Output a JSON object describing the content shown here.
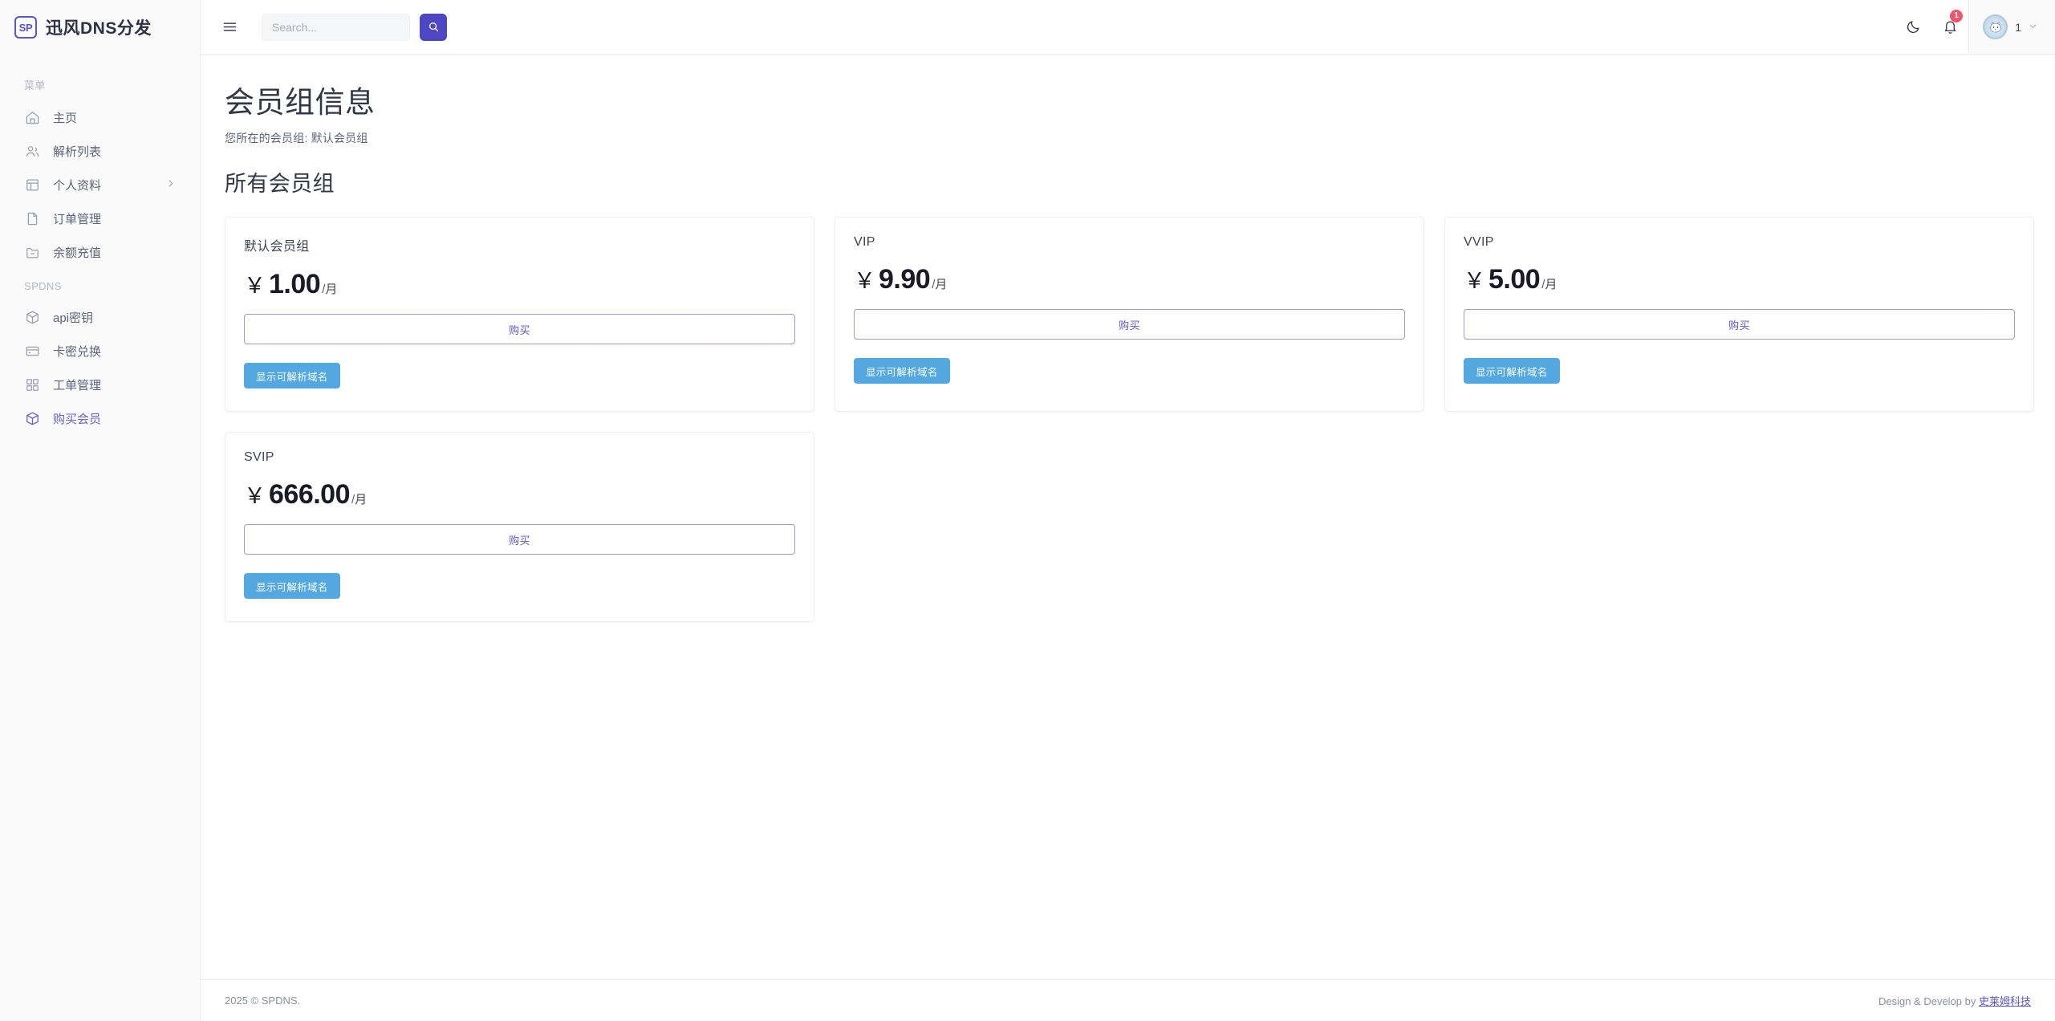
{
  "brand": {
    "logo_text": "SP",
    "name": "迅风DNS分发"
  },
  "sidebar": {
    "sections": [
      {
        "title": "菜单",
        "items": [
          {
            "label": "主页",
            "icon": "home-icon",
            "active": false,
            "chevron": false
          },
          {
            "label": "解析列表",
            "icon": "users-icon",
            "active": false,
            "chevron": false
          },
          {
            "label": "个人资料",
            "icon": "layout-icon",
            "active": false,
            "chevron": true
          },
          {
            "label": "订单管理",
            "icon": "file-icon",
            "active": false,
            "chevron": false
          },
          {
            "label": "余额充值",
            "icon": "folder-minus-icon",
            "active": false,
            "chevron": false
          }
        ]
      },
      {
        "title": "SPDNS",
        "items": [
          {
            "label": "api密钥",
            "icon": "box-icon",
            "active": false,
            "chevron": false
          },
          {
            "label": "卡密兑换",
            "icon": "credit-card-icon",
            "active": false,
            "chevron": false
          },
          {
            "label": "工单管理",
            "icon": "grid-icon",
            "active": false,
            "chevron": false
          },
          {
            "label": "购买会员",
            "icon": "package-icon",
            "active": true,
            "chevron": false
          }
        ]
      }
    ]
  },
  "topbar": {
    "menu_toggle": "hamburger-icon",
    "search": {
      "placeholder": "Search...",
      "value": "",
      "button_icon": "search-icon"
    },
    "dark_mode_icon": "moon-icon",
    "notifications": {
      "icon": "bell-icon",
      "badge": "1"
    },
    "user": {
      "name": "1",
      "avatar": "cat-avatar",
      "caret": "chevron-down-icon"
    }
  },
  "page": {
    "title": "会员组信息",
    "subtitle": "您所在的会员组: 默认会员组",
    "section_title": "所有会员组",
    "buy_label": "购买",
    "domains_label": "显示可解析域名",
    "currency_symbol": "￥",
    "period_separator": "/",
    "period_unit": "月",
    "groups": [
      {
        "name": "默认会员组",
        "price": "1.00"
      },
      {
        "name": "VIP",
        "price": "9.90"
      },
      {
        "name": "VVIP",
        "price": "5.00"
      },
      {
        "name": "SVIP",
        "price": "666.00"
      }
    ]
  },
  "footer": {
    "left": "2025 © SPDNS.",
    "right_prefix": "Design & Develop by ",
    "right_link": "史莱姆科技"
  },
  "colors": {
    "accent_indigo": "#4d47c3",
    "accent_purple_text": "#5b56c4",
    "button_blue": "#53a8e2",
    "badge_red": "#f1556c",
    "sidebar_bg": "#fafafb"
  }
}
